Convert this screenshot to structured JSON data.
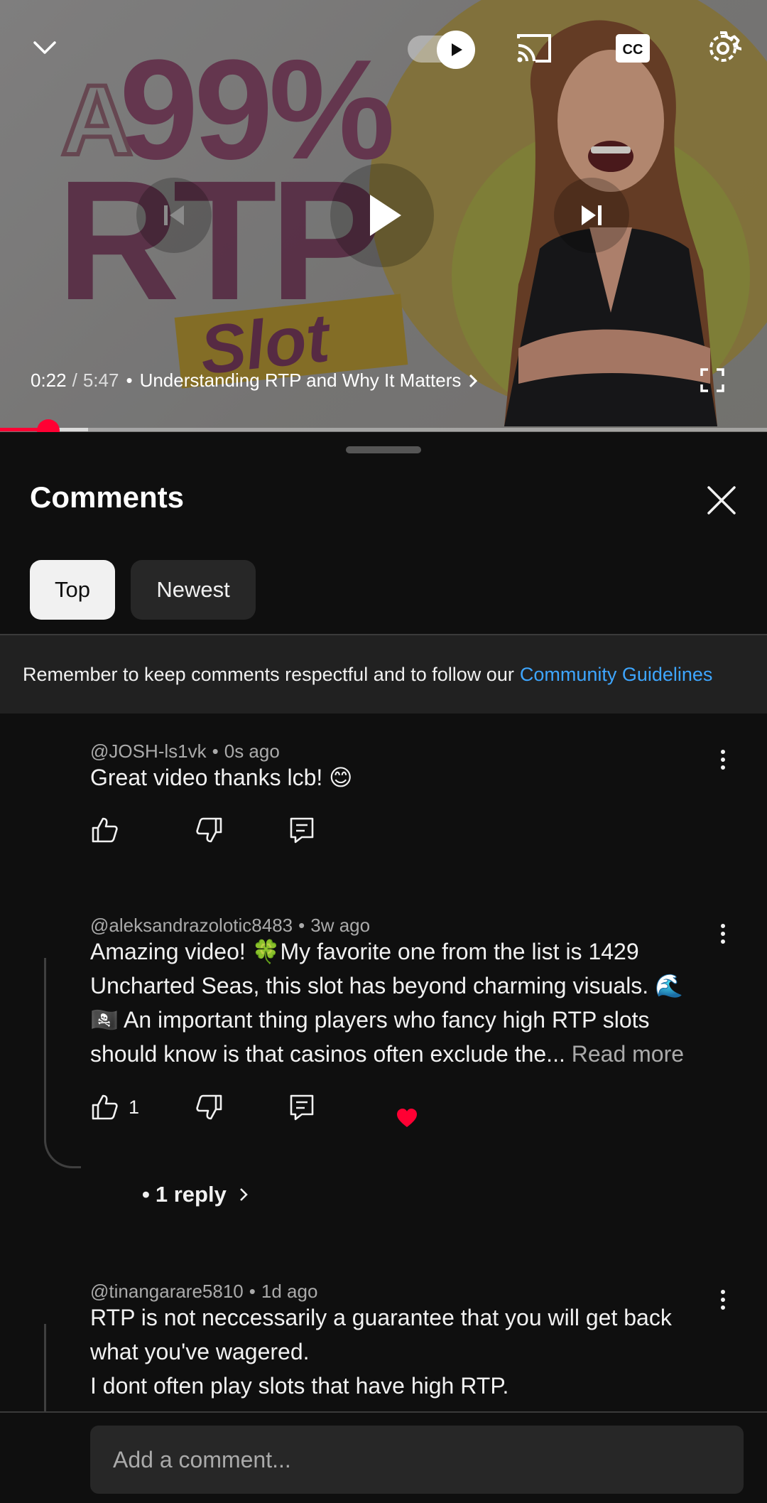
{
  "player": {
    "current_time": "0:22",
    "duration": "5:47",
    "time_separator": "/",
    "chapter_title": "Understanding RTP and Why It Matters",
    "progress_fraction": 0.063,
    "thumbnail_text": {
      "a": "A",
      "percent": "99%",
      "rtp": "RTP",
      "slot": "Slot"
    }
  },
  "comments_panel": {
    "title": "Comments",
    "filters": [
      {
        "label": "Top",
        "selected": true
      },
      {
        "label": "Newest",
        "selected": false
      }
    ],
    "guideline_text": "Remember to keep comments respectful and to follow our",
    "guideline_link": "Community Guidelines"
  },
  "comments": [
    {
      "author": "@JOSH-ls1vk",
      "time": "0s ago",
      "text": "Great video thanks lcb! 😊",
      "likes": ""
    },
    {
      "author": "@aleksandrazolotic8483",
      "time": "3w ago",
      "text": "Amazing video! 🍀My favorite one from the list is 1429 Uncharted Seas, this slot has beyond charming visuals.  🌊 🏴‍☠️ An important thing players who fancy high RTP slots should know is that casinos often exclude the...",
      "read_more": "Read more",
      "likes": "1",
      "creator_heart": true,
      "reply_label": "1 reply"
    },
    {
      "author": "@tinangarare5810",
      "time": "1d ago",
      "text_lines": [
        "RTP is not neccessarily a guarantee that you will get back what you've wagered.",
        "I dont often play slots that have high RTP."
      ]
    }
  ],
  "composer": {
    "placeholder": "Add a comment..."
  },
  "colors": {
    "accent_red": "#ff0033",
    "link_blue": "#3ea6ff",
    "background": "#0f0f0f"
  },
  "icons": [
    "chevron-down-icon",
    "autoplay-toggle-icon",
    "cast-icon",
    "cc-icon",
    "gear-icon",
    "previous-icon",
    "play-icon",
    "next-icon",
    "fullscreen-icon",
    "close-icon",
    "like-icon",
    "dislike-icon",
    "reply-icon",
    "heart-icon",
    "more-icon"
  ]
}
